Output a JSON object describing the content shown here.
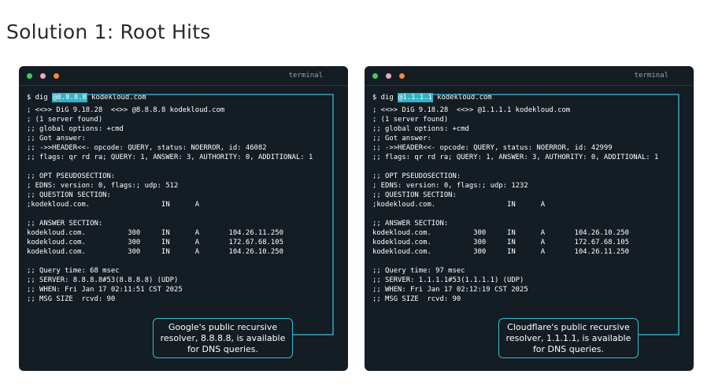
{
  "page": {
    "title": "Solution 1: Root Hits"
  },
  "terminals": [
    {
      "window_label": "terminal",
      "prompt": "$ dig ",
      "server_ip": "@8.8.8.8",
      "domain": " kodekloud.com",
      "lines": [
        "; <<>> DiG 9.18.28  <<>> @8.8.8.8 kodekloud.com",
        "; (1 server found)",
        ";; global options: +cmd",
        ";; Got answer:",
        ";; ->>HEADER<<- opcode: QUERY, status: NOERROR, id: 46082",
        ";; flags: qr rd ra; QUERY: 1, ANSWER: 3, AUTHORITY: 0, ADDITIONAL: 1",
        "",
        ";; OPT PSEUDOSECTION:",
        "; EDNS: version: 0, flags:; udp: 512",
        ";; QUESTION SECTION:",
        ";kodekloud.com.                 IN      A",
        "",
        ";; ANSWER SECTION:",
        "kodekloud.com.          300     IN      A       104.26.11.250",
        "kodekloud.com.          300     IN      A       172.67.68.105",
        "kodekloud.com.          300     IN      A       104.26.10.250",
        "",
        ";; Query time: 68 msec",
        ";; SERVER: 8.8.8.8#53(8.8.8.8) (UDP)",
        ";; WHEN: Fri Jan 17 02:11:51 CST 2025",
        ";; MSG SIZE  rcvd: 90"
      ],
      "callout": "Google's public recursive resolver, 8.8.8.8, is available for DNS queries."
    },
    {
      "window_label": "terminal",
      "prompt": "$ dig ",
      "server_ip": "@1.1.1.1",
      "domain": " kodekloud.com",
      "lines": [
        "; <<>> DiG 9.18.28  <<>> @1.1.1.1 kodekloud.com",
        "; (1 server found)",
        ";; global options: +cmd",
        ";; Got answer:",
        ";; ->>HEADER<<- opcode: QUERY, status: NOERROR, id: 42999",
        ";; flags: qr rd ra; QUERY: 1, ANSWER: 3, AUTHORITY: 0, ADDITIONAL: 1",
        "",
        ";; OPT PSEUDOSECTION:",
        "; EDNS: version: 0, flags:; udp: 1232",
        ";; QUESTION SECTION:",
        ";kodekloud.com.                 IN      A",
        "",
        ";; ANSWER SECTION:",
        "kodekloud.com.          300     IN      A       104.26.10.250",
        "kodekloud.com.          300     IN      A       172.67.68.105",
        "kodekloud.com.          300     IN      A       104.26.11.250",
        "",
        ";; Query time: 97 msec",
        ";; SERVER: 1.1.1.1#53(1.1.1.1) (UDP)",
        ";; WHEN: Fri Jan 17 02:12:19 CST 2025",
        ";; MSG SIZE  rcvd: 90"
      ],
      "callout": "Cloudflare's public recursive resolver, 1.1.1.1, is available for DNS queries."
    }
  ],
  "colors": {
    "terminal_bg": "#141c24",
    "highlight": "#2fb3c6",
    "callout_border": "#36c0d0"
  }
}
